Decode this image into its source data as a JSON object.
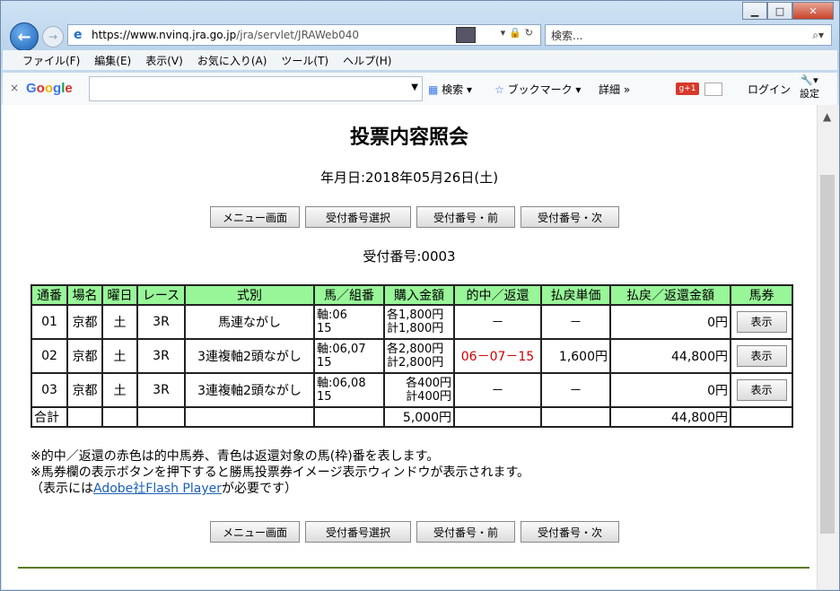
{
  "browser": {
    "url_host": "https://www.nvinq.jra.go.jp",
    "url_path": "/jra/servlet/JRAWeb040",
    "search_placeholder": "検索...",
    "menu": [
      "ファイル(F)",
      "編集(E)",
      "表示(V)",
      "お気に入り(A)",
      "ツール(T)",
      "ヘルプ(H)"
    ],
    "google_bar": {
      "logo": "Google",
      "search_label": "検索",
      "bookmark_label": "ブックマーク",
      "detail_label": "詳細 »",
      "gplus_label": "+1",
      "login_label": "ログイン",
      "settings_label": "設定"
    }
  },
  "page": {
    "title": "投票内容照会",
    "date_text": "年月日:2018年05月26日(土)",
    "buttons": {
      "menu": "メニュー画面",
      "select": "受付番号選択",
      "prev": "受付番号・前",
      "next": "受付番号・次"
    },
    "receipt_text": "受付番号:0003",
    "table": {
      "headers": [
        "通番",
        "場名",
        "曜日",
        "レース",
        "式別",
        "馬／組番",
        "購入金額",
        "的中／返還",
        "払戻単価",
        "払戻／返還金額",
        "馬券"
      ],
      "rows": [
        {
          "no": "01",
          "place": "京都",
          "day": "土",
          "race": "3R",
          "type": "馬連ながし",
          "combo1": "軸:06",
          "combo2": "15",
          "amt1": "各1,800円",
          "amt2": "計1,800円",
          "hit": "－",
          "unit": "－",
          "payout": "0円",
          "ticket": "表示"
        },
        {
          "no": "02",
          "place": "京都",
          "day": "土",
          "race": "3R",
          "type": "3連複軸2頭ながし",
          "combo1": "軸:06,07",
          "combo2": "15",
          "amt1": "各2,800円",
          "amt2": "計2,800円",
          "hit": "06－07－15",
          "unit": "1,600円",
          "payout": "44,800円",
          "ticket": "表示"
        },
        {
          "no": "03",
          "place": "京都",
          "day": "土",
          "race": "3R",
          "type": "3連複軸2頭ながし",
          "combo1": "軸:06,08",
          "combo2": "15",
          "amt1": "各400円",
          "amt2": "計400円",
          "hit": "－",
          "unit": "－",
          "payout": "0円",
          "ticket": "表示"
        }
      ],
      "total": {
        "label": "合計",
        "amount": "5,000円",
        "payout": "44,800円"
      }
    },
    "notes": {
      "line1": "※的中／返還の赤色は的中馬券、青色は返還対象の馬(枠)番を表します。",
      "line2": "※馬券欄の表示ボタンを押下すると勝馬投票券イメージ表示ウィンドウが表示されます。",
      "line3_pre": "（表示には",
      "line3_link": "Adobe社Flash Player",
      "line3_post": "が必要です）"
    }
  },
  "colors": {
    "header_bg": "#98f598",
    "hit_red": "#d00000",
    "link": "#1a5fb4"
  }
}
